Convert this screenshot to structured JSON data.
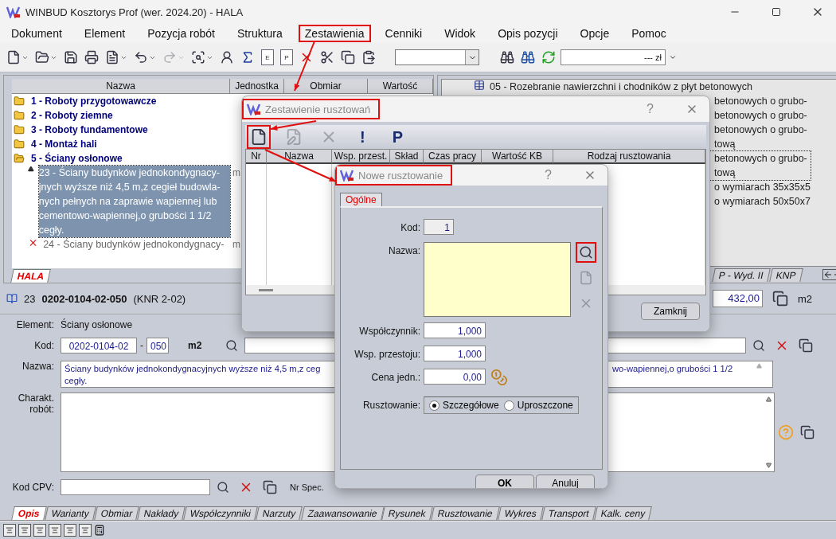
{
  "window": {
    "title": "WINBUD Kosztorys Prof (wer. 2024.20) - HALA"
  },
  "menu": [
    {
      "label": "Dokument",
      "highlighted": false
    },
    {
      "label": "Element",
      "highlighted": false
    },
    {
      "label": "Pozycja robót",
      "highlighted": false
    },
    {
      "label": "Struktura",
      "highlighted": false
    },
    {
      "label": "Zestawienia",
      "highlighted": true
    },
    {
      "label": "Cenniki",
      "highlighted": false
    },
    {
      "label": "Widok",
      "highlighted": false
    },
    {
      "label": "Opis pozycji",
      "highlighted": false
    },
    {
      "label": "Opcje",
      "highlighted": false
    },
    {
      "label": "Pomoc",
      "highlighted": false
    }
  ],
  "toolbar": {
    "buttons": [
      {
        "caret": true,
        "disabled": false
      },
      {
        "caret": true,
        "disabled": false
      },
      {
        "caret": false,
        "disabled": false
      },
      {
        "caret": false,
        "disabled": false
      },
      {
        "caret": true,
        "disabled": false
      },
      {
        "caret": true,
        "disabled": false
      },
      {
        "caret": true,
        "disabled": true
      },
      {
        "caret": true,
        "disabled": false
      },
      {
        "caret": false,
        "disabled": false
      },
      {
        "caret": false,
        "disabled": false
      },
      {
        "caret": false,
        "disabled": false,
        "label": "E"
      },
      {
        "caret": false,
        "disabled": false,
        "label": "P"
      },
      {
        "caret": false,
        "disabled": false
      },
      {
        "caret": false,
        "disabled": false
      },
      {
        "caret": false,
        "disabled": false
      },
      {
        "caret": false,
        "disabled": false
      }
    ],
    "amount_field": {
      "value": "--- zł"
    }
  },
  "tree": {
    "columns": [
      "Nazwa",
      "Jednostka",
      "Obmiar",
      "Wartość"
    ],
    "items": [
      {
        "label": "1 - Roboty przygotowawcze",
        "expanded": false
      },
      {
        "label": "2 - Roboty ziemne",
        "expanded": false
      },
      {
        "label": "3 - Roboty fundamentowe",
        "expanded": false
      },
      {
        "label": "4 - Montaż hali",
        "expanded": false
      },
      {
        "label": "5 - Ściany osłonowe",
        "expanded": true,
        "children": [
          {
            "label": "23 - Ściany budynków jednokondygnacy-jnych wyższe niż 4,5 m,z cegieł budowla-nych pełnych na zaprawie wapiennej lub cementowo-wapiennej,o grubości 1 1/2 cegły.",
            "unit": "m",
            "selected": true,
            "excluded": false
          },
          {
            "label": "24 - Ściany budynków jednokondygnacy-",
            "unit": "m",
            "selected": false,
            "excluded": true
          }
        ]
      }
    ],
    "tabs": [
      {
        "label": "HALA",
        "selected": true
      }
    ]
  },
  "catalog": {
    "items": [
      {
        "kind": "group",
        "lines": [
          "05 - Rozebranie nawierzchni i chodników z płyt betonowych"
        ],
        "selected": false
      },
      {
        "kind": "position",
        "lines": [
          "betonowych o grubo-"
        ],
        "selected": false
      },
      {
        "kind": "position",
        "lines": [
          "betonowych o grubo-"
        ],
        "selected": false
      },
      {
        "kind": "position",
        "lines": [
          "betonowych o grubo-",
          "tową"
        ],
        "selected": false
      },
      {
        "kind": "position",
        "lines": [
          "betonowych o grubo-",
          "tową"
        ],
        "selected": true
      },
      {
        "kind": "position",
        "lines": [
          "o wymiarach 35x35x5"
        ],
        "selected": false
      },
      {
        "kind": "position",
        "lines": [
          "o wymiarach 50x50x7"
        ],
        "selected": false
      }
    ],
    "tabs": [
      {
        "label": "P - Wyd. II"
      },
      {
        "label": "KNP"
      }
    ]
  },
  "position_bar": {
    "number": "23",
    "code": "0202-0104-02-050",
    "source": "(KNR 2-02)",
    "quantity": "432,00",
    "unit": "m2"
  },
  "form": {
    "element_label": "Element:",
    "element_value": "Ściany osłonowe",
    "kod_label": "Kod:",
    "kod_value": "0202-0104-02",
    "kod_separator": "-",
    "kod_suffix": "050",
    "unit": "m2",
    "nazwa_label": "Nazwa:",
    "nazwa_left_lines": [
      "Ściany budynków jednokondygnacyjnych wyższe niż 4,5 m,z ceg",
      "cegły."
    ],
    "nazwa_right": "wo-wapiennej,o grubości 1 1/2",
    "charakt_label": "Charakt. robót:",
    "cpv_label": "Kod CPV:",
    "spec_label": "Nr Spec."
  },
  "bottom_tabs": [
    {
      "label": "Opis",
      "selected": true
    },
    {
      "label": "Warianty",
      "selected": false
    },
    {
      "label": "Obmiar",
      "selected": false
    },
    {
      "label": "Nakłady",
      "selected": false
    },
    {
      "label": "Współczynniki",
      "selected": false
    },
    {
      "label": "Narzuty",
      "selected": false
    },
    {
      "label": "Zaawansowanie",
      "selected": false
    },
    {
      "label": "Rysunek",
      "selected": false
    },
    {
      "label": "Rusztowanie",
      "selected": false
    },
    {
      "label": "Wykres",
      "selected": false
    },
    {
      "label": "Transport",
      "selected": false
    },
    {
      "label": "Kalk. ceny",
      "selected": false
    }
  ],
  "summary_dialog": {
    "title": "Zestawienie rusztowań",
    "title_highlighted": true,
    "help": "?",
    "tools": [
      {
        "kind": "new",
        "disabled": false,
        "highlighted": true
      },
      {
        "kind": "edit",
        "disabled": true,
        "highlighted": false
      },
      {
        "kind": "delete",
        "disabled": true,
        "highlighted": false
      },
      {
        "kind": "text",
        "label": "!",
        "disabled": false,
        "highlighted": false
      },
      {
        "kind": "text",
        "label": "P",
        "disabled": false,
        "highlighted": false
      }
    ],
    "columns": [
      "Nr",
      "Nazwa",
      "Wsp. przest.",
      "Skład",
      "Czas pracy",
      "Wartość KB",
      "Rodzaj rusztowania"
    ],
    "close_button": "Zamknij"
  },
  "new_dialog": {
    "title": "Nowe rusztowanie",
    "title_highlighted": true,
    "help": "?",
    "tabs": [
      {
        "label": "Ogólne",
        "selected": true
      }
    ],
    "kod": {
      "label": "Kod:",
      "value": "1"
    },
    "nazwa": {
      "label": "Nazwa:"
    },
    "side_buttons": [
      {
        "kind": "search",
        "disabled": false,
        "highlighted": true
      },
      {
        "kind": "new",
        "disabled": true,
        "highlighted": false
      },
      {
        "kind": "delete",
        "disabled": true,
        "highlighted": false
      }
    ],
    "fields": [
      {
        "label": "Współczynnik:",
        "value": "1,000"
      },
      {
        "label": "Wsp. przestoju:",
        "value": "1,000"
      },
      {
        "label": "Cena jedn.:",
        "value": "0,00"
      }
    ],
    "radio_label": "Rusztowanie:",
    "options": [
      {
        "label": "Szczegółowe",
        "selected": true
      },
      {
        "label": "Uproszczone",
        "selected": false
      }
    ],
    "buttons": [
      "OK",
      "Anuluj"
    ]
  }
}
